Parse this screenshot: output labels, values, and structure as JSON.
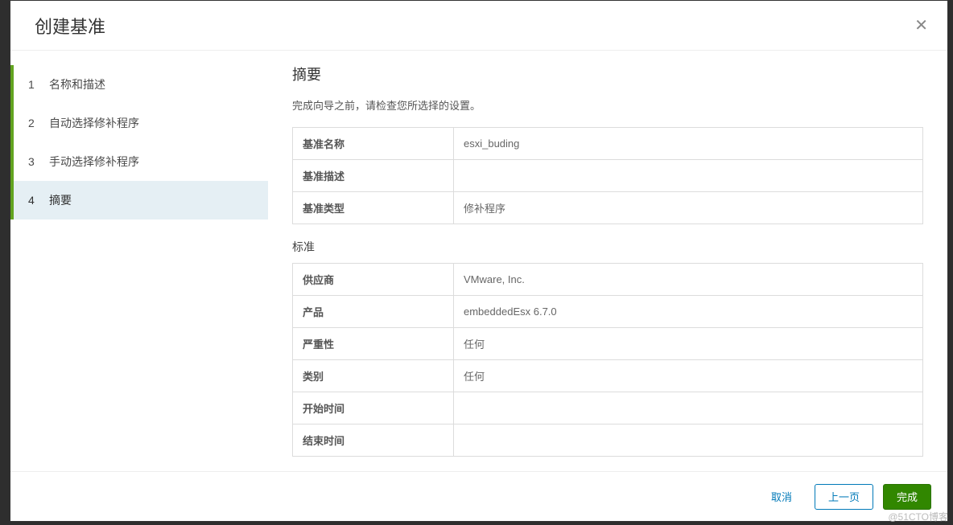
{
  "modal": {
    "title": "创建基准"
  },
  "steps": [
    {
      "num": "1",
      "label": "名称和描述"
    },
    {
      "num": "2",
      "label": "自动选择修补程序"
    },
    {
      "num": "3",
      "label": "手动选择修补程序"
    },
    {
      "num": "4",
      "label": "摘要"
    }
  ],
  "content": {
    "title": "摘要",
    "subtitle": "完成向导之前，请检查您所选择的设置。",
    "section1_label": "标准",
    "table1": {
      "r0k": "基准名称",
      "r0v": "esxi_buding",
      "r1k": "基准描述",
      "r1v": "",
      "r2k": "基准类型",
      "r2v": "修补程序"
    },
    "table2": {
      "r0k": "供应商",
      "r0v": "VMware, Inc.",
      "r1k": "产品",
      "r1v": "embeddedEsx 6.7.0",
      "r2k": "严重性",
      "r2v": "任何",
      "r3k": "类别",
      "r3v": "任何",
      "r4k": "开始时间",
      "r4v": "",
      "r5k": "结束时间",
      "r5v": ""
    }
  },
  "footer": {
    "cancel": "取消",
    "back": "上一页",
    "finish": "完成"
  },
  "watermark": "@51CTO博客"
}
